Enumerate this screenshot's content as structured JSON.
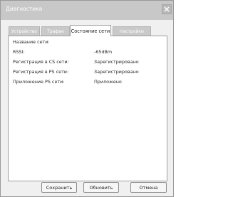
{
  "window": {
    "title": "Диагностика"
  },
  "tabs": [
    {
      "label": "Устройство"
    },
    {
      "label": "Трафик"
    },
    {
      "label": "Состояние сети"
    },
    {
      "label": "Настройки"
    }
  ],
  "status": {
    "rows": [
      {
        "label": "Название сети:",
        "value": ""
      },
      {
        "label": "RSSI:",
        "value": "-65dBm"
      },
      {
        "label": "Регистрация в CS сети:",
        "value": "Зарегистрировано"
      },
      {
        "label": "Регистрация в PS сети:",
        "value": "Зарегистрировано"
      },
      {
        "label": "Приложение PS сети:",
        "value": "Приложено"
      }
    ]
  },
  "buttons": {
    "save": "Сохранить",
    "refresh": "Обновить",
    "cancel": "Отмена"
  },
  "icons": {
    "close": "close-icon"
  }
}
